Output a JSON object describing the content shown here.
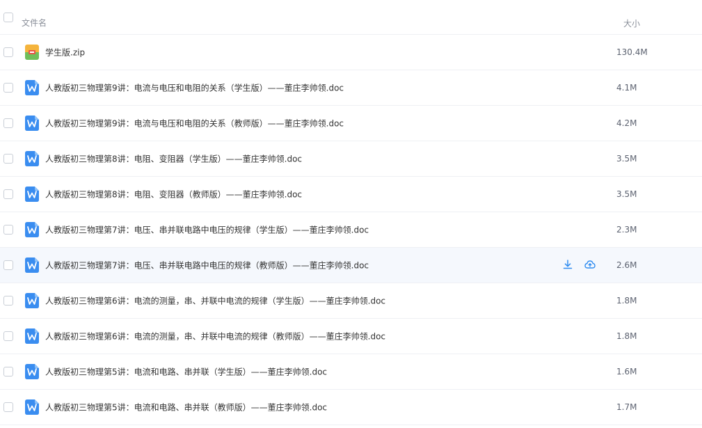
{
  "header": {
    "name_label": "文件名",
    "size_label": "大小"
  },
  "colors": {
    "accent": "#2f8cf0",
    "doc_icon": "#3a8df0",
    "zip_icon_top": "#f5b43c",
    "zip_icon_bottom": "#6fbf5a",
    "zip_icon_lock": "#e8554a"
  },
  "files": [
    {
      "name": "学生版.zip",
      "size": "130.4M",
      "icon": "zip-icon"
    },
    {
      "name": "人教版初三物理第9讲：电流与电压和电阻的关系（学生版）——董庄李帅领.doc",
      "size": "4.1M",
      "icon": "word-doc-icon"
    },
    {
      "name": "人教版初三物理第9讲：电流与电压和电阻的关系（教师版）——董庄李帅领.doc",
      "size": "4.2M",
      "icon": "word-doc-icon"
    },
    {
      "name": "人教版初三物理第8讲：电阻、变阻器（学生版）——董庄李帅领.doc",
      "size": "3.5M",
      "icon": "word-doc-icon"
    },
    {
      "name": "人教版初三物理第8讲：电阻、变阻器（教师版）——董庄李帅领.doc",
      "size": "3.5M",
      "icon": "word-doc-icon"
    },
    {
      "name": "人教版初三物理第7讲：电压、串并联电路中电压的规律（学生版）——董庄李帅领.doc",
      "size": "2.3M",
      "icon": "word-doc-icon"
    },
    {
      "name": "人教版初三物理第7讲：电压、串并联电路中电压的规律（教师版）——董庄李帅领.doc",
      "size": "2.6M",
      "icon": "word-doc-icon"
    },
    {
      "name": "人教版初三物理第6讲：电流的测量，串、并联中电流的规律（学生版）——董庄李帅领.doc",
      "size": "1.8M",
      "icon": "word-doc-icon"
    },
    {
      "name": "人教版初三物理第6讲：电流的测量，串、并联中电流的规律（教师版）——董庄李帅领.doc",
      "size": "1.8M",
      "icon": "word-doc-icon"
    },
    {
      "name": "人教版初三物理第5讲：电流和电路、串并联（学生版）——董庄李帅领.doc",
      "size": "1.6M",
      "icon": "word-doc-icon"
    },
    {
      "name": "人教版初三物理第5讲：电流和电路、串并联（教师版）——董庄李帅领.doc",
      "size": "1.7M",
      "icon": "word-doc-icon"
    }
  ]
}
